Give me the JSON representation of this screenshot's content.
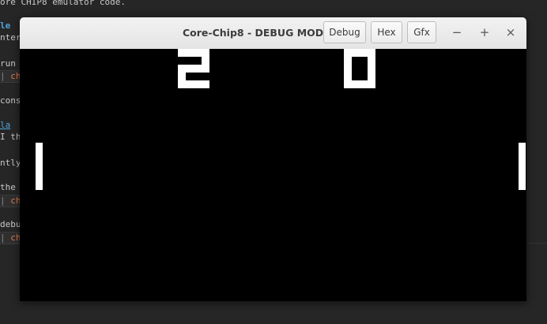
{
  "editor": {
    "lines": [
      {
        "text": "ore CHIP8 emulator code.",
        "kind": "plain"
      },
      {
        "text": "le",
        "kind": "heading"
      },
      {
        "text": "nter",
        "kind": "plain"
      },
      {
        "text": "run",
        "kind": "plain"
      },
      {
        "text": "conso",
        "kind": "plain"
      },
      {
        "text": "la",
        "kind": "link"
      },
      {
        "text": "I tha",
        "kind": "plain"
      },
      {
        "text": "ntly",
        "kind": "plain"
      },
      {
        "text": "the",
        "kind": "plain"
      },
      {
        "text": "debu",
        "kind": "plain"
      }
    ],
    "code_blocks": [
      {
        "gutter": "|",
        "text": " chi"
      },
      {
        "gutter": "|",
        "text": " chi"
      },
      {
        "gutter": "|",
        "text": " chi"
      }
    ]
  },
  "window": {
    "title": "Core-Chip8 - DEBUG MODE",
    "buttons": {
      "debug": "Debug",
      "hex": "Hex",
      "gfx": "Gfx"
    },
    "controls": {
      "minimize": "−",
      "maximize": "+",
      "close": "×"
    }
  },
  "game": {
    "score_left": 2,
    "score_right": 0,
    "foreground_color": "#ffffff",
    "background_color": "#000000"
  }
}
